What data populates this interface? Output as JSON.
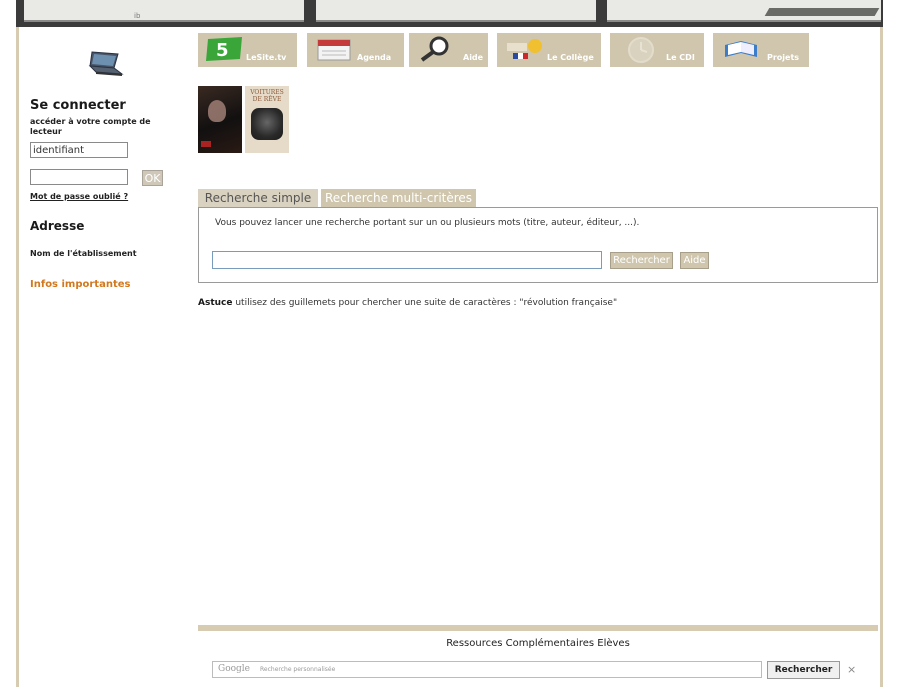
{
  "sidebar": {
    "login_title": "Se connecter",
    "login_subtitle": "accéder à votre compte de lecteur",
    "username_value": "identifiant",
    "ok_label": "OK",
    "forgot_password": "Mot de passe oublié ?",
    "address_title": "Adresse",
    "school_name": "Nom de l'établissement",
    "important_info": "Infos importantes"
  },
  "nav": {
    "tabs": [
      {
        "label": "LeSite.tv",
        "icon": "lesite-tv-icon"
      },
      {
        "label": "Agenda",
        "icon": "calendar-icon"
      },
      {
        "label": "Aide",
        "icon": "magnifier-icon"
      },
      {
        "label": "Le Collège",
        "icon": "college-icon"
      },
      {
        "label": "Le CDI",
        "icon": "clock-icon"
      },
      {
        "label": "Projets",
        "icon": "book-icon"
      }
    ]
  },
  "covers": {
    "second_title": "VOITURES DE RÊVE"
  },
  "search": {
    "tab_simple": "Recherche simple",
    "tab_multi": "Recherche multi-critères",
    "description": "Vous pouvez lancer une recherche portant sur un ou plusieurs mots (titre, auteur, éditeur, ...).",
    "search_button": "Rechercher",
    "help_button": "Aide",
    "tip_label": "Astuce",
    "tip_text": " utilisez des guillemets pour chercher une suite de caractères : \"révolution française\""
  },
  "footer": {
    "title": "Ressources Complémentaires Elèves",
    "google_logo": "Google",
    "google_placeholder": "Recherche personnalisée",
    "search_button": "Rechercher",
    "clear_symbol": "×"
  },
  "colors": {
    "accent_tan": "#cfc6ad",
    "frame": "#d7cbb2",
    "important_orange": "#d2791f"
  }
}
